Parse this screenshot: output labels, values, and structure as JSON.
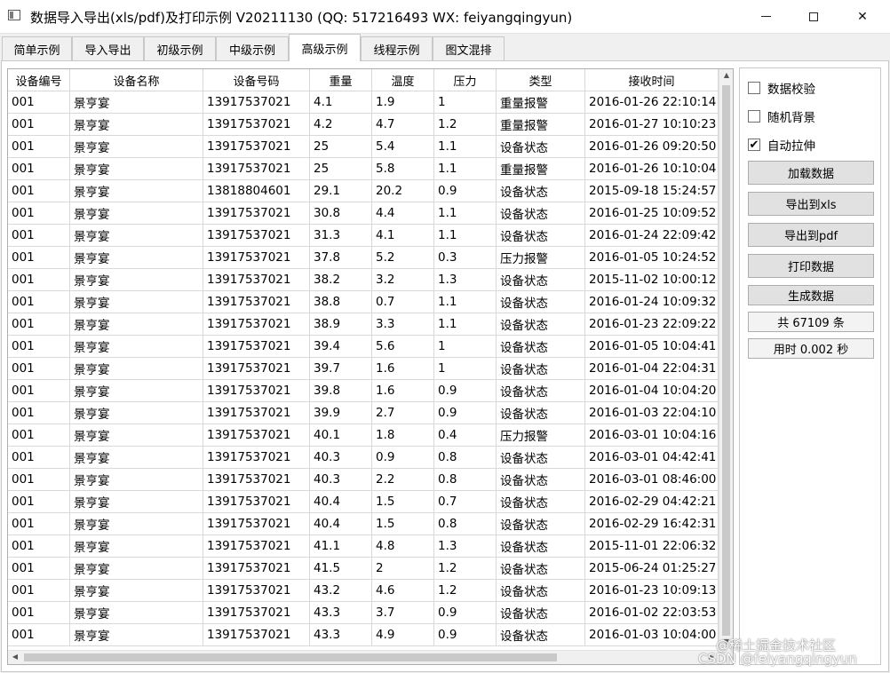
{
  "window": {
    "title": "数据导入导出(xls/pdf)及打印示例 V20211130 (QQ: 517216493 WX: feiyangqingyun)",
    "close_glyph": "✕"
  },
  "tabs": [
    {
      "label": "简单示例"
    },
    {
      "label": "导入导出"
    },
    {
      "label": "初级示例"
    },
    {
      "label": "中级示例"
    },
    {
      "label": "高级示例",
      "active": true
    },
    {
      "label": "线程示例"
    },
    {
      "label": "图文混排"
    }
  ],
  "table": {
    "columns": [
      "设备编号",
      "设备名称",
      "设备号码",
      "重量",
      "温度",
      "压力",
      "类型",
      "接收时间"
    ],
    "rows": [
      [
        "001",
        "景亨宴",
        "13917537021",
        "4.1",
        "1.9",
        "1",
        "重量报警",
        "2016-01-26 22:10:14"
      ],
      [
        "001",
        "景亨宴",
        "13917537021",
        "4.2",
        "4.7",
        "1.2",
        "重量报警",
        "2016-01-27 10:10:23"
      ],
      [
        "001",
        "景亨宴",
        "13917537021",
        "25",
        "5.4",
        "1.1",
        "设备状态",
        "2016-01-26 09:20:50"
      ],
      [
        "001",
        "景亨宴",
        "13917537021",
        "25",
        "5.8",
        "1.1",
        "重量报警",
        "2016-01-26 10:10:04"
      ],
      [
        "001",
        "景亨宴",
        "13818804601",
        "29.1",
        "20.2",
        "0.9",
        "设备状态",
        "2015-09-18 15:24:57"
      ],
      [
        "001",
        "景亨宴",
        "13917537021",
        "30.8",
        "4.4",
        "1.1",
        "设备状态",
        "2016-01-25 10:09:52"
      ],
      [
        "001",
        "景亨宴",
        "13917537021",
        "31.3",
        "4.1",
        "1.1",
        "设备状态",
        "2016-01-24 22:09:42"
      ],
      [
        "001",
        "景亨宴",
        "13917537021",
        "37.8",
        "5.2",
        "0.3",
        "压力报警",
        "2016-01-05 10:24:52"
      ],
      [
        "001",
        "景亨宴",
        "13917537021",
        "38.2",
        "3.2",
        "1.3",
        "设备状态",
        "2015-11-02 10:00:12"
      ],
      [
        "001",
        "景亨宴",
        "13917537021",
        "38.8",
        "0.7",
        "1.1",
        "设备状态",
        "2016-01-24 10:09:32"
      ],
      [
        "001",
        "景亨宴",
        "13917537021",
        "38.9",
        "3.3",
        "1.1",
        "设备状态",
        "2016-01-23 22:09:22"
      ],
      [
        "001",
        "景亨宴",
        "13917537021",
        "39.4",
        "5.6",
        "1",
        "设备状态",
        "2016-01-05 10:04:41"
      ],
      [
        "001",
        "景亨宴",
        "13917537021",
        "39.7",
        "1.6",
        "1",
        "设备状态",
        "2016-01-04 22:04:31"
      ],
      [
        "001",
        "景亨宴",
        "13917537021",
        "39.8",
        "1.6",
        "0.9",
        "设备状态",
        "2016-01-04 10:04:20"
      ],
      [
        "001",
        "景亨宴",
        "13917537021",
        "39.9",
        "2.7",
        "0.9",
        "设备状态",
        "2016-01-03 22:04:10"
      ],
      [
        "001",
        "景亨宴",
        "13917537021",
        "40.1",
        "1.8",
        "0.4",
        "压力报警",
        "2016-03-01 10:04:16"
      ],
      [
        "001",
        "景亨宴",
        "13917537021",
        "40.3",
        "0.9",
        "0.8",
        "设备状态",
        "2016-03-01 04:42:41"
      ],
      [
        "001",
        "景亨宴",
        "13917537021",
        "40.3",
        "2.2",
        "0.8",
        "设备状态",
        "2016-03-01 08:46:00"
      ],
      [
        "001",
        "景亨宴",
        "13917537021",
        "40.4",
        "1.5",
        "0.7",
        "设备状态",
        "2016-02-29 04:42:21"
      ],
      [
        "001",
        "景亨宴",
        "13917537021",
        "40.4",
        "1.5",
        "0.8",
        "设备状态",
        "2016-02-29 16:42:31"
      ],
      [
        "001",
        "景亨宴",
        "13917537021",
        "41.1",
        "4.8",
        "1.3",
        "设备状态",
        "2015-11-01 22:06:32"
      ],
      [
        "001",
        "景亨宴",
        "13917537021",
        "41.5",
        "2",
        "1.2",
        "设备状态",
        "2015-06-24 01:25:27"
      ],
      [
        "001",
        "景亨宴",
        "13917537021",
        "43.2",
        "4.6",
        "1.2",
        "设备状态",
        "2016-01-23 10:09:13"
      ],
      [
        "001",
        "景亨宴",
        "13917537021",
        "43.3",
        "3.7",
        "0.9",
        "设备状态",
        "2016-01-02 22:03:53"
      ],
      [
        "001",
        "景亨宴",
        "13917537021",
        "43.3",
        "4.9",
        "0.9",
        "设备状态",
        "2016-01-03 10:04:00"
      ]
    ]
  },
  "panel": {
    "checkboxes": [
      {
        "label": "数据校验",
        "checked": false
      },
      {
        "label": "随机背景",
        "checked": false
      },
      {
        "label": "自动拉伸",
        "checked": true
      }
    ],
    "check_glyph": "✔",
    "buttons": {
      "load": "加载数据",
      "export_xls": "导出到xls",
      "export_pdf": "导出到pdf",
      "print": "打印数据",
      "generate": "生成数据"
    },
    "count_text": "共 67109 条",
    "time_text": "用时 0.002 秒"
  },
  "watermark": {
    "line1": "@稀土掘金技术社区",
    "line2": "CSDN @feiyangqingyun"
  }
}
